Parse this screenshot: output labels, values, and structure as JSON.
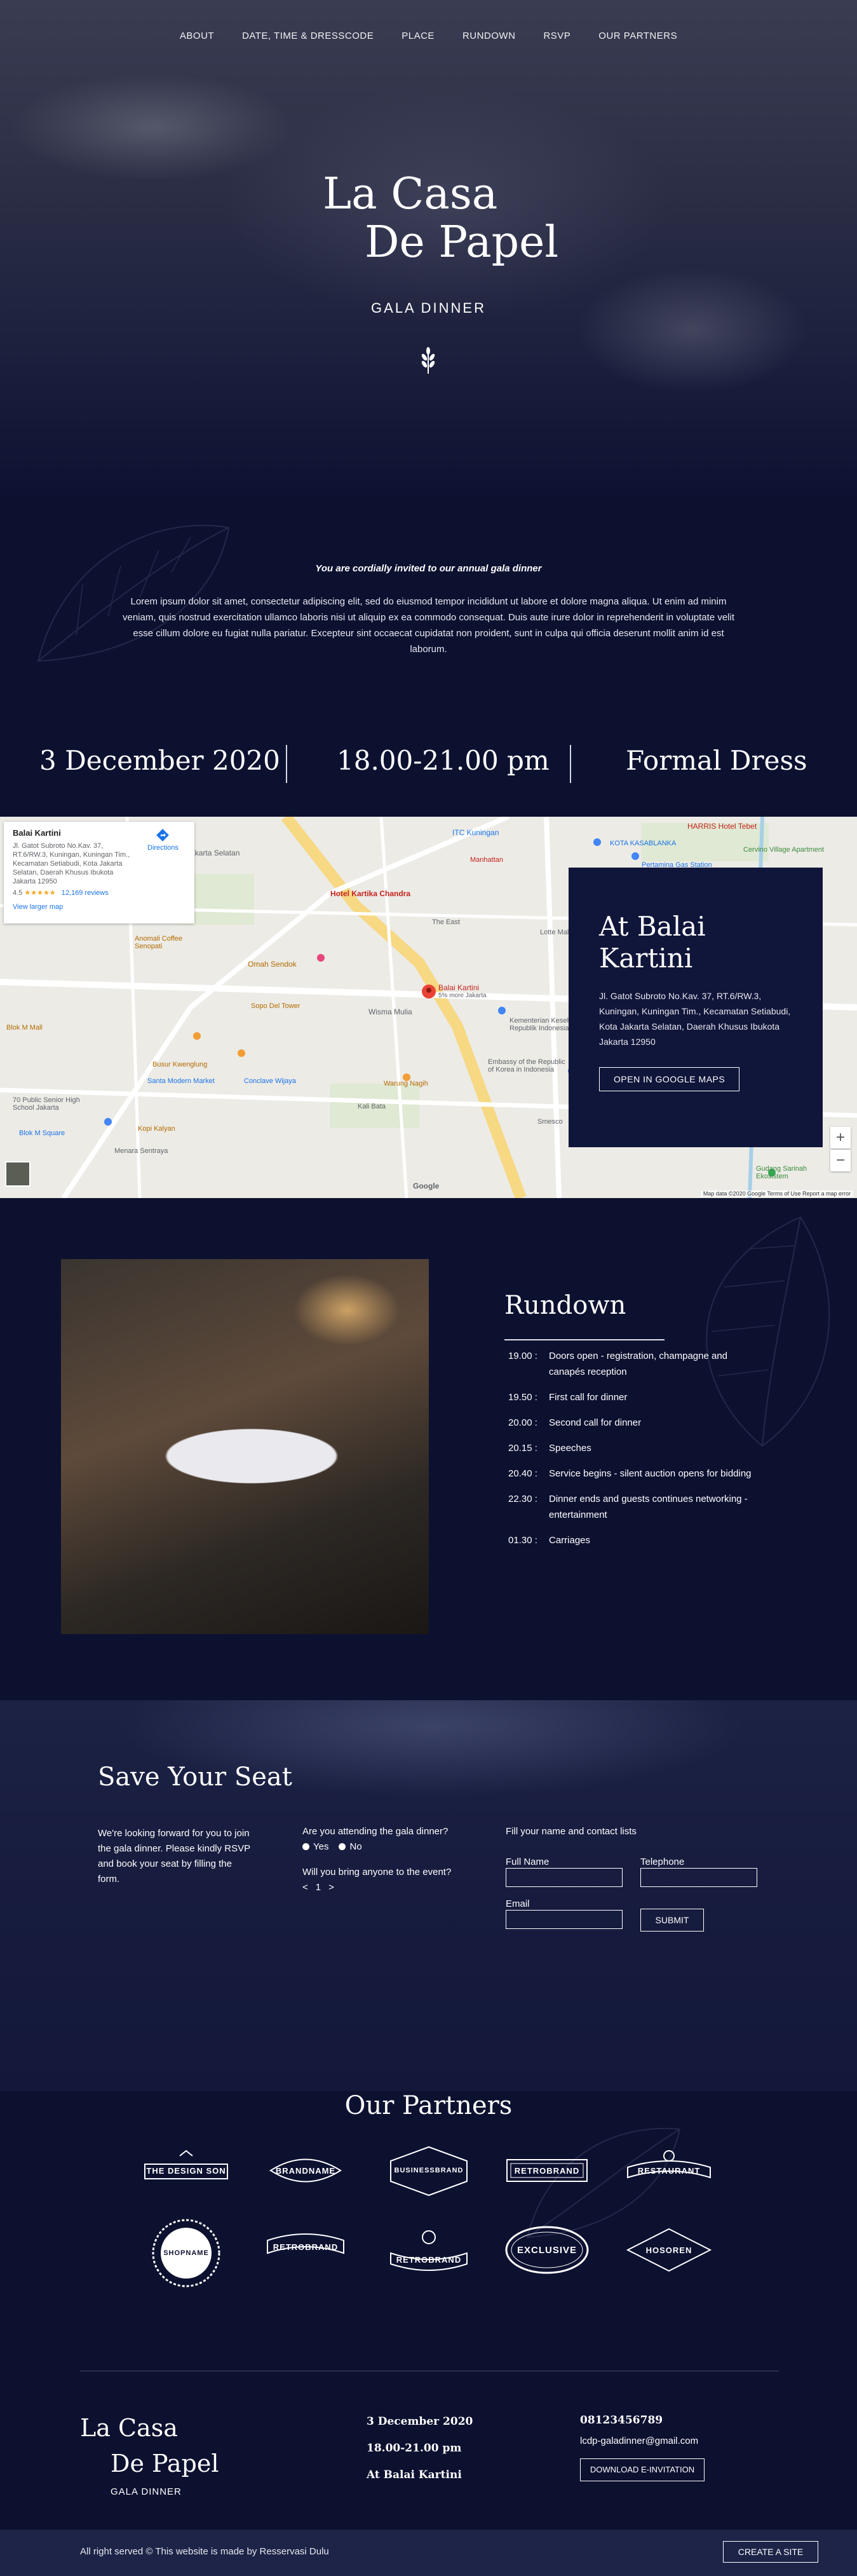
{
  "nav": [
    "ABOUT",
    "DATE, TIME & DRESSCODE",
    "PLACE",
    "RUNDOWN",
    "RSVP",
    "OUR PARTNERS"
  ],
  "hero": {
    "title_line1": "La Casa",
    "title_line2": "De Papel",
    "subtitle": "GALA DINNER",
    "ornament_icon": "wheat-ornament-icon"
  },
  "intro": {
    "tagline": "You are cordially invited to our annual gala dinner",
    "body": "Lorem ipsum dolor sit amet, consectetur adipiscing elit, sed do eiusmod tempor incididunt ut labore et dolore magna aliqua. Ut enim ad minim veniam, quis nostrud exercitation ullamco laboris nisi ut aliquip ex ea commodo consequat. Duis aute irure dolor in reprehenderit in voluptate velit esse cillum dolore eu fugiat nulla pariatur. Excepteur sint occaecat cupidatat non proident, sunt in culpa qui officia deserunt mollit anim id est laborum."
  },
  "details": {
    "date": "3 December 2020",
    "time": "18.00-21.00 pm",
    "dress": "Formal Dress"
  },
  "map": {
    "card_title_1": "At Balai",
    "card_title_2": "Kartini",
    "address": "Jl. Gatot Subroto No.Kav. 37, RT.6/RW.3, Kuningan, Kuningan Tim., Kecamatan Setiabudi, Kota Jakarta Selatan, Daerah Khusus Ibukota Jakarta 12950",
    "button": "OPEN IN GOOGLE MAPS",
    "info_title": "Balai Kartini",
    "info_address": "Jl. Gatot Subroto No.Kav. 37, RT.6/RW.3, Kuningan, Kuningan Tim., Kecamatan Setiabudi, Kota Jakarta Selatan, Daerah Khusus Ibukota Jakarta 12950",
    "info_rating": "4.5",
    "info_stars": "★★★★★",
    "info_reviews": "12,169 reviews",
    "info_directions": "Directions",
    "info_larger": "View larger map",
    "pin_label": "Balai Kartini",
    "pin_sub": "5% more Jakarta",
    "labels": [
      "Samsat Jakarta Selatan",
      "ITC Kuningan",
      "HARRIS Hotel Tebet",
      "KOTA KASABLANKA",
      "Cervino Village Apartment",
      "Manhattan",
      "Pertamina Gas Station",
      "Hotel Kartika Chandra",
      "The East",
      "Omah Sendok",
      "Sopo Del Tower",
      "Wisma Mulia",
      "Kementerian Kesehatan Republik Indonesia",
      "Embassy of the Republic of Korea in Indonesia",
      "Warung Nagih",
      "Santa Modern Market",
      "Conclave Wijaya",
      "Kali Bata",
      "Busur Kwenglung",
      "Kopi Kalyan",
      "Menara Sentraya",
      "Blok M Square",
      "70 Public Senior High School Jakarta",
      "Anomali Coffee Senopati",
      "Gudang Sarinah Ekosistem",
      "Blok M Mall",
      "Smesco",
      "Lotte Mall"
    ],
    "zoom_in": "+",
    "zoom_out": "−",
    "attribution": "Map data ©2020 Google   Terms of Use   Report a map error",
    "google": "Google"
  },
  "rundown": {
    "title": "Rundown",
    "items": [
      {
        "time": "19.00 :",
        "text": "Doors open - registration, champagne and canapés reception"
      },
      {
        "time": "19.50 :",
        "text": "First call for dinner"
      },
      {
        "time": "20.00 :",
        "text": "Second call for dinner"
      },
      {
        "time": "20.15 :",
        "text": "Speeches"
      },
      {
        "time": "20.40 :",
        "text": "Service begins - silent auction opens for bidding"
      },
      {
        "time": "22.30 :",
        "text": "Dinner ends and guests continues networking - entertainment"
      },
      {
        "time": "01.30 :",
        "text": "Carriages"
      }
    ]
  },
  "rsvp": {
    "title": "Save Your Seat",
    "text": "We're looking forward for you to join the gala dinner. Please kindly RSVP and book your seat by filling the form.",
    "attending_q": "Are you attending the gala dinner?",
    "yes": "Yes",
    "no": "No",
    "bring_q": "Will you bring anyone to the event?",
    "stepper_prev": "<",
    "stepper_value": "1",
    "stepper_next": ">",
    "fill_label": "Fill your name and contact lists",
    "full_name": "Full Name",
    "telephone": "Telephone",
    "email": "Email",
    "submit": "SUBMIT"
  },
  "partners": {
    "title": "Our Partners",
    "logos": [
      "THE DESIGN SON",
      "BRANDNAME",
      "BUSINESSBRAND",
      "RETROBRAND",
      "RESTAURANT",
      "SHOPNAME",
      "RETROBRAND",
      "RETROBRAND",
      "EXCLUSIVE",
      "HOSOREN"
    ]
  },
  "footer": {
    "title_line1": "La Casa",
    "title_line2": "De Papel",
    "subtitle": "GALA DINNER",
    "date": "3 December 2020",
    "time": "18.00-21.00 pm",
    "place": "At Balai Kartini",
    "phone": "08123456789",
    "email": "lcdp-galadinner@gmail.com",
    "download": "DOWNLOAD E-INVITATION",
    "copyright": "All right served © This website is made by Resservasi Dulu",
    "create": "CREATE A SITE"
  }
}
